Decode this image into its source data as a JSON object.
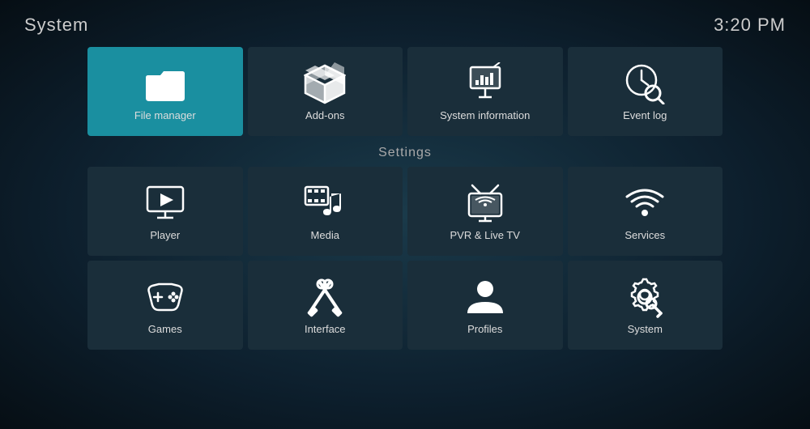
{
  "header": {
    "title": "System",
    "time": "3:20 PM"
  },
  "top_tiles": [
    {
      "id": "file-manager",
      "label": "File manager",
      "active": true
    },
    {
      "id": "add-ons",
      "label": "Add-ons",
      "active": false
    },
    {
      "id": "system-information",
      "label": "System information",
      "active": false
    },
    {
      "id": "event-log",
      "label": "Event log",
      "active": false
    }
  ],
  "settings_label": "Settings",
  "settings_rows": [
    [
      {
        "id": "player",
        "label": "Player"
      },
      {
        "id": "media",
        "label": "Media"
      },
      {
        "id": "pvr-live-tv",
        "label": "PVR & Live TV"
      },
      {
        "id": "services",
        "label": "Services"
      }
    ],
    [
      {
        "id": "games",
        "label": "Games"
      },
      {
        "id": "interface",
        "label": "Interface"
      },
      {
        "id": "profiles",
        "label": "Profiles"
      },
      {
        "id": "system",
        "label": "System"
      }
    ]
  ]
}
